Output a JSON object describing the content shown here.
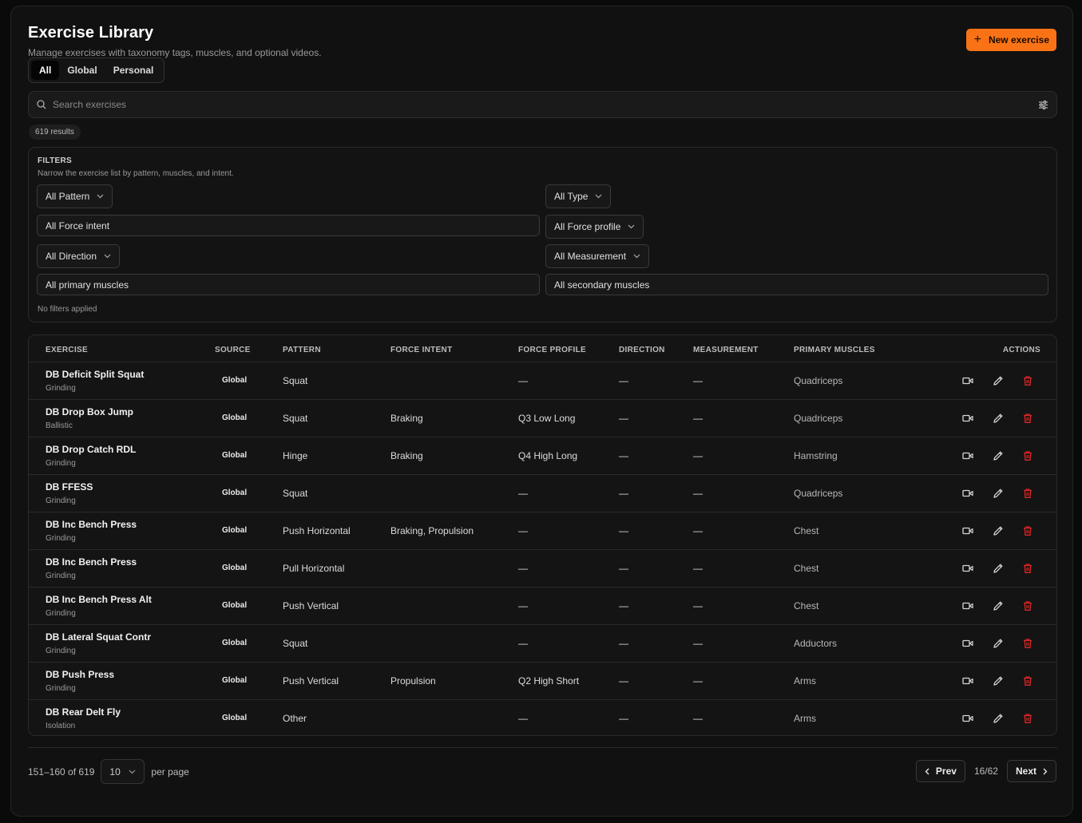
{
  "header": {
    "title": "Exercise Library",
    "subtitle": "Manage exercises with taxonomy tags, muscles, and optional videos.",
    "new_button": "New exercise"
  },
  "scope_tabs": [
    {
      "label": "All",
      "active": true
    },
    {
      "label": "Global",
      "active": false
    },
    {
      "label": "Personal",
      "active": false
    }
  ],
  "search": {
    "placeholder": "Search exercises",
    "value": ""
  },
  "results_badge": "619 results",
  "filters": {
    "title": "FILTERS",
    "subtitle": "Narrow the exercise list by pattern, muscles, and intent.",
    "pattern": "All Pattern",
    "type": "All Type",
    "force_intent": "All Force intent",
    "force_profile": "All Force profile",
    "direction": "All Direction",
    "measurement": "All Measurement",
    "primary_muscles": "All primary muscles",
    "secondary_muscles": "All secondary muscles",
    "status": "No filters applied"
  },
  "table": {
    "columns": [
      "EXERCISE",
      "SOURCE",
      "PATTERN",
      "FORCE INTENT",
      "FORCE PROFILE",
      "DIRECTION",
      "MEASUREMENT",
      "PRIMARY MUSCLES",
      "ACTIONS"
    ],
    "rows": [
      {
        "name": "DB Deficit Split Squat",
        "type": "Grinding",
        "source": "Global",
        "pattern": "Squat",
        "force_intent": "",
        "force_profile": "—",
        "direction": "—",
        "measurement": "—",
        "muscles": "Quadriceps"
      },
      {
        "name": "DB Drop Box Jump",
        "type": "Ballistic",
        "source": "Global",
        "pattern": "Squat",
        "force_intent": "Braking",
        "force_profile": "Q3 Low Long",
        "direction": "—",
        "measurement": "—",
        "muscles": "Quadriceps"
      },
      {
        "name": "DB Drop Catch RDL",
        "type": "Grinding",
        "source": "Global",
        "pattern": "Hinge",
        "force_intent": "Braking",
        "force_profile": "Q4 High Long",
        "direction": "—",
        "measurement": "—",
        "muscles": "Hamstring"
      },
      {
        "name": "DB FFESS",
        "type": "Grinding",
        "source": "Global",
        "pattern": "Squat",
        "force_intent": "",
        "force_profile": "—",
        "direction": "—",
        "measurement": "—",
        "muscles": "Quadriceps"
      },
      {
        "name": "DB Inc Bench Press",
        "type": "Grinding",
        "source": "Global",
        "pattern": "Push Horizontal",
        "force_intent": "Braking, Propulsion",
        "force_profile": "—",
        "direction": "—",
        "measurement": "—",
        "muscles": "Chest"
      },
      {
        "name": "DB Inc Bench Press",
        "type": "Grinding",
        "source": "Global",
        "pattern": "Pull Horizontal",
        "force_intent": "",
        "force_profile": "—",
        "direction": "—",
        "measurement": "—",
        "muscles": "Chest"
      },
      {
        "name": "DB Inc Bench Press Alt",
        "type": "Grinding",
        "source": "Global",
        "pattern": "Push Vertical",
        "force_intent": "",
        "force_profile": "—",
        "direction": "—",
        "measurement": "—",
        "muscles": "Chest"
      },
      {
        "name": "DB Lateral Squat Contr",
        "type": "Grinding",
        "source": "Global",
        "pattern": "Squat",
        "force_intent": "",
        "force_profile": "—",
        "direction": "—",
        "measurement": "—",
        "muscles": "Adductors"
      },
      {
        "name": "DB Push Press",
        "type": "Grinding",
        "source": "Global",
        "pattern": "Push Vertical",
        "force_intent": "Propulsion",
        "force_profile": "Q2 High Short",
        "direction": "—",
        "measurement": "—",
        "muscles": "Arms"
      },
      {
        "name": "DB Rear Delt Fly",
        "type": "Isolation",
        "source": "Global",
        "pattern": "Other",
        "force_intent": "",
        "force_profile": "—",
        "direction": "—",
        "measurement": "—",
        "muscles": "Arms"
      }
    ]
  },
  "pagination": {
    "range": "151–160 of 619",
    "per_page_value": "10",
    "per_page_label": "per page",
    "prev": "Prev",
    "page": "16/62",
    "next": "Next"
  },
  "icons": {
    "new": "plus-icon",
    "search": "search-icon",
    "filter_toggle": "sliders-icon",
    "video": "video-icon",
    "edit": "pencil-icon",
    "delete": "trash-icon"
  },
  "colors": {
    "accent": "#f97316",
    "danger": "#dc2626",
    "background": "#111111"
  }
}
